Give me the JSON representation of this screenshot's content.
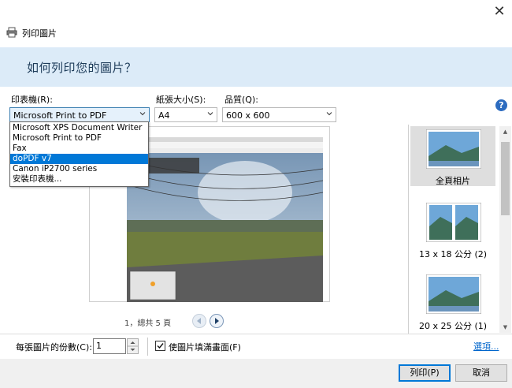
{
  "window": {
    "title": "列印圖片",
    "close_glyph": "✕"
  },
  "header": {
    "question": "如何列印您的圖片？"
  },
  "printer": {
    "label": "印表機(R):",
    "selected": "Microsoft Print to PDF",
    "options": [
      "Microsoft XPS Document Writer",
      "Microsoft Print to PDF",
      "Fax",
      "doPDF v7",
      "Canon iP2700 series",
      "安裝印表機..."
    ],
    "highlighted_index": 3
  },
  "paper": {
    "label": "紙張大小(S):",
    "selected": "A4"
  },
  "quality": {
    "label": "品質(Q):",
    "selected": "600 x 600"
  },
  "help": {
    "glyph": "?"
  },
  "preview": {
    "pager_text": "1，總共 5 頁"
  },
  "layouts": [
    {
      "label": "全頁相片",
      "selected": true
    },
    {
      "label": "13 x 18 公分 (2)",
      "selected": false
    },
    {
      "label": "20 x 25 公分 (1)",
      "selected": false
    }
  ],
  "copies": {
    "label": "每張圖片的份數(C):",
    "value": "1"
  },
  "fit": {
    "label": "使圖片填滿畫面(F)",
    "checked": true
  },
  "options_link": "選項...",
  "buttons": {
    "print": "列印(P)",
    "cancel": "取消"
  },
  "colors": {
    "header_band": "#dcebf8",
    "accent": "#0078d7",
    "link": "#0066cc"
  }
}
